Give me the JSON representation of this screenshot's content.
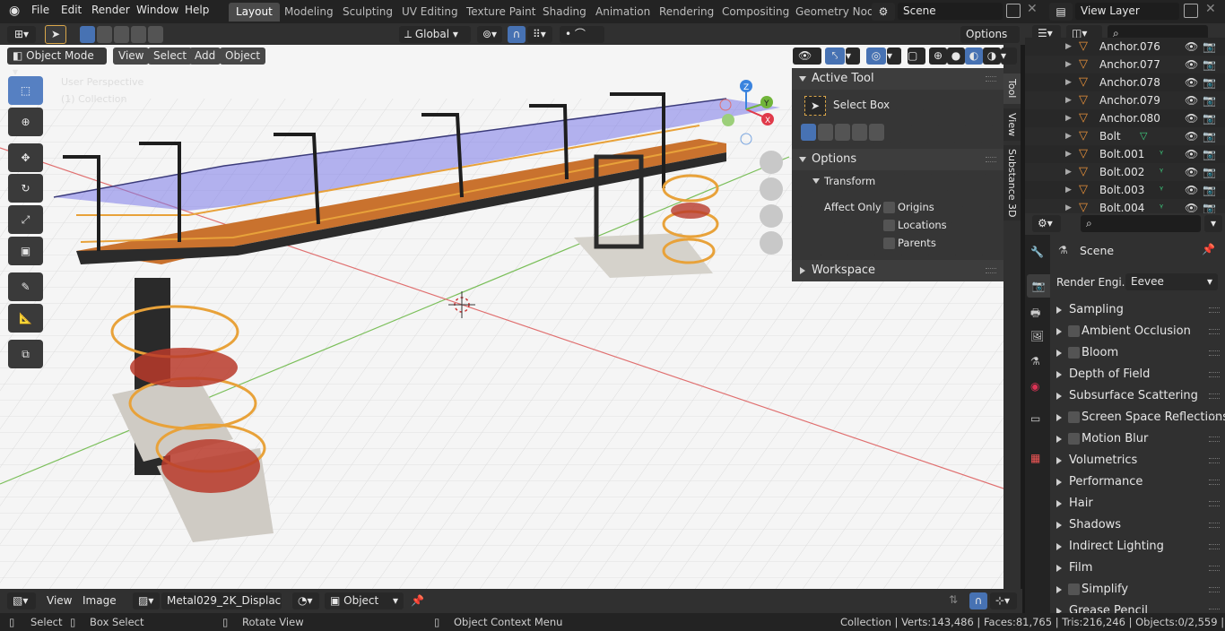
{
  "menu": [
    "File",
    "Edit",
    "Render",
    "Window",
    "Help"
  ],
  "workspaces": [
    "Layout",
    "Modeling",
    "Sculpting",
    "UV Editing",
    "Texture Paint",
    "Shading",
    "Animation",
    "Rendering",
    "Compositing",
    "Geometry Nod"
  ],
  "scene_name": "Scene",
  "view_layer": "View Layer",
  "viewport_header": {
    "orientation": "Global",
    "options": "Options"
  },
  "viewport_menu": {
    "mode": "Object Mode",
    "view": "View",
    "select": "Select",
    "add": "Add",
    "object": "Object"
  },
  "overlay_text": {
    "perspective": "User Perspective",
    "collection": "(1) Collection"
  },
  "npanel": {
    "active_tool_title": "Active Tool",
    "tool_name": "Select Box",
    "options_title": "Options",
    "transform_title": "Transform",
    "affect_only": "Affect Only",
    "origins": "Origins",
    "locations": "Locations",
    "parents": "Parents",
    "workspace_title": "Workspace"
  },
  "sidebar_tabs": [
    "Tool",
    "View",
    "Substance 3D"
  ],
  "outliner_rows": [
    {
      "name": "Anchor.076"
    },
    {
      "name": "Anchor.077"
    },
    {
      "name": "Anchor.078"
    },
    {
      "name": "Anchor.079"
    },
    {
      "name": "Anchor.080"
    },
    {
      "name": "Bolt"
    },
    {
      "name": "Bolt.001"
    },
    {
      "name": "Bolt.002"
    },
    {
      "name": "Bolt.003"
    },
    {
      "name": "Bolt.004"
    }
  ],
  "properties": {
    "context": "Scene",
    "render_engine_label": "Render Engi...",
    "render_engine": "Eevee",
    "sections": [
      {
        "label": "Sampling",
        "check": false
      },
      {
        "label": "Ambient Occlusion",
        "check": true
      },
      {
        "label": "Bloom",
        "check": true
      },
      {
        "label": "Depth of Field",
        "check": false
      },
      {
        "label": "Subsurface Scattering",
        "check": false
      },
      {
        "label": "Screen Space Reflections",
        "check": true
      },
      {
        "label": "Motion Blur",
        "check": true
      },
      {
        "label": "Volumetrics",
        "check": false
      },
      {
        "label": "Performance",
        "check": false
      },
      {
        "label": "Hair",
        "check": false
      },
      {
        "label": "Shadows",
        "check": false
      },
      {
        "label": "Indirect Lighting",
        "check": false
      },
      {
        "label": "Film",
        "check": false
      },
      {
        "label": "Simplify",
        "check": true
      },
      {
        "label": "Grease Pencil",
        "check": false
      }
    ]
  },
  "bottom_header": {
    "view": "View",
    "image": "Image",
    "image_name": "Metal029_2K_Displacem",
    "object": "Object"
  },
  "status": {
    "select": "Select",
    "box_select": "Box Select",
    "rotate": "Rotate View",
    "context_menu": "Object Context Menu",
    "stats": "Collection | Verts:143,486 | Faces:81,765 | Tris:216,246 | Objects:0/2,559 | 2.93.5"
  },
  "colors": {
    "accent": "#4772b3",
    "x_axis": "#e03a4a",
    "y_axis": "#71b53a",
    "z_axis": "#3a83de",
    "orange_rail": "#e8a23a",
    "red_stairs": "#b83a2a",
    "glass": "#7a78e8"
  }
}
